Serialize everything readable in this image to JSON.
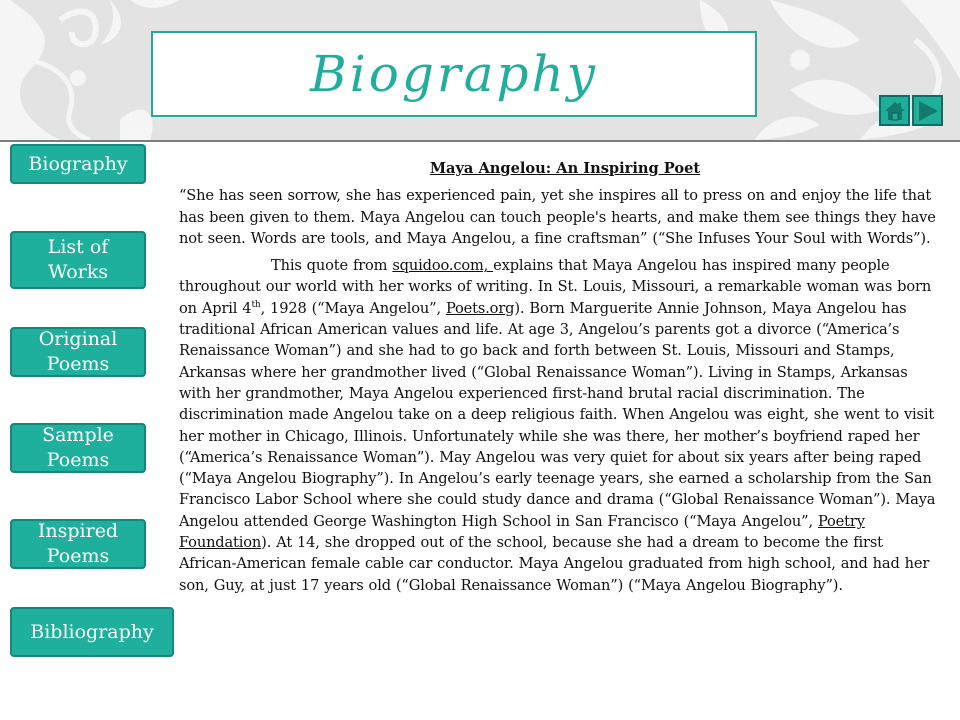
{
  "header": {
    "title": "Biography",
    "nav": [
      {
        "icon": "home-icon",
        "label": "Home"
      },
      {
        "icon": "next-arrow-icon",
        "label": "Next"
      }
    ]
  },
  "sidebar": {
    "items": [
      {
        "label_lines": [
          "Biography"
        ]
      },
      {
        "label_lines": [
          "List of",
          "Works"
        ]
      },
      {
        "label_lines": [
          "Original",
          "Poems"
        ]
      },
      {
        "label_lines": [
          "Sample",
          "Poems"
        ]
      },
      {
        "label_lines": [
          "Inspired",
          "Poems"
        ]
      },
      {
        "label_lines": [
          "Bibliography"
        ]
      }
    ]
  },
  "colors": {
    "accent": "#1fb09d",
    "accent_border": "#16877a",
    "title_text": "#22ae9c",
    "banner_bg": "#e3e3e3"
  },
  "main": {
    "heading": "Maya Angelou: An Inspiring Poet",
    "quote": "“She has seen sorrow, she has experienced pain, yet she inspires all to press on and enjoy the life that has been given to them.  Maya Angelou can touch people's hearts, and make them see things they have not seen.  Words are tools, and Maya Angelou, a fine craftsman” (“She Infuses Your Soul with Words”).",
    "body": {
      "p1": "This quote from ",
      "link1": "squidoo.com, ",
      "p2": " explains that Maya Angelou has inspired many people throughout our world with her works of writing. In St. Louis, Missouri, a remarkable woman was born on April 4",
      "sup1": "th",
      "p3": ", 1928 (“Maya Angelou”, ",
      "link2": "Poets.org",
      "p4": "). Born Marguerite Annie Johnson, Maya Angelou has traditional African American values and life. At age 3, Angelou’s parents got a divorce (“America’s Renaissance Woman”) and she had to go back and forth between St. Louis, Missouri and Stamps, Arkansas where her grandmother lived (“Global Renaissance Woman”). Living in Stamps, Arkansas with her grandmother, Maya Angelou experienced first-hand brutal racial discrimination.  The discrimination made Angelou take on a deep religious faith. When Angelou was eight, she went to visit her mother in Chicago, Illinois.  Unfortunately while she was there, her mother’s boyfriend raped her (“America’s Renaissance Woman”). May Angelou was very quiet for about six years after being raped (“Maya Angelou Biography”).  In Angelou’s early teenage years, she earned a scholarship from the San Francisco Labor School where she could study dance and drama (“Global Renaissance Woman”). Maya Angelou attended George Washington High School in San Francisco (“Maya Angelou”, ",
      "link3": "Poetry Foundation",
      "p5": ").  At 14, she dropped out of the school, because she had a dream to become the first African-American female cable car conductor.  Maya Angelou graduated from high school, and had her son, Guy, at just 17 years old (“Global Renaissance Woman”) (“Maya Angelou Biography”)."
    }
  }
}
